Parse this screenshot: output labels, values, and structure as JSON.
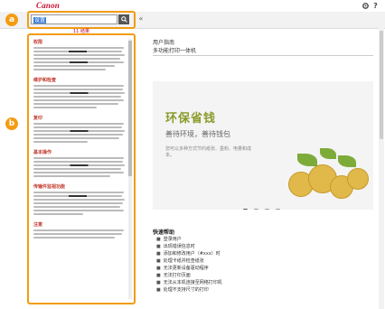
{
  "header": {
    "logo": "Canon",
    "settings_icon": "gear-icon",
    "help_icon": "question-icon",
    "help_symbol": "?"
  },
  "search": {
    "query": "设置",
    "button_icon": "search-icon",
    "collapse_icon": "chevron-left-icon",
    "collapse_symbol": "«"
  },
  "markers": {
    "a": "a",
    "b": "b"
  },
  "results": {
    "label": "11 结果",
    "items": [
      {
        "title": "权限"
      },
      {
        "title": "维护和检查"
      },
      {
        "title": "复印"
      },
      {
        "title": "基本操作"
      },
      {
        "title": "传输件监视功能"
      },
      {
        "title": "注意"
      }
    ]
  },
  "document": {
    "title": "用户指南",
    "subtitle": "多功能打印一体机"
  },
  "banner": {
    "title": "环保省钱",
    "subtitle": "善待环境，善待钱包",
    "description": "您可以多种方式节约纸张、墨粉、电量和成本。"
  },
  "quick": {
    "title": "快速帮助",
    "items": [
      "登录用户",
      "出现错误信息时",
      "添加和修改用户（#xxx）时",
      "处理卡纸并检查纸张",
      "无法更新设备驱动程序",
      "无法打印页面",
      "无法从本机连接至网络打印机",
      "处理不支持尺寸的打印"
    ]
  },
  "colors": {
    "accent": "#f39c12",
    "brand": "#c8102e",
    "result_title": "#c0392b",
    "banner_title": "#8a9a2a"
  }
}
